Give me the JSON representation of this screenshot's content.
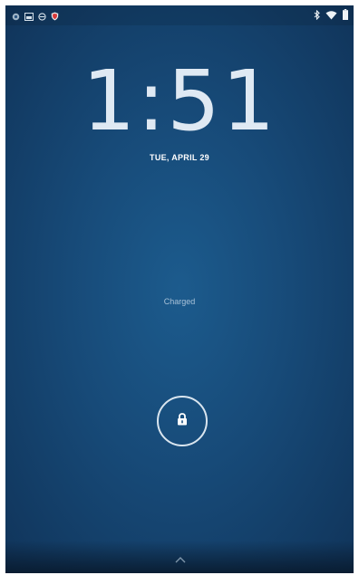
{
  "status_bar": {
    "left_icons": [
      "app-icon",
      "image-icon",
      "media-icon",
      "shield-icon"
    ],
    "right_icons": [
      "bluetooth-icon",
      "wifi-icon",
      "battery-icon"
    ]
  },
  "lockscreen": {
    "time": "1:51",
    "date": "TUE, APRIL 29",
    "charging_status": "Charged",
    "unlock_icon": "lock-icon",
    "swipe_hint_icon": "chevron-up-icon"
  },
  "colors": {
    "background": "#174a78",
    "background_edge": "#10345a",
    "text": "#ffffff",
    "muted_text": "#a9c2d8"
  }
}
